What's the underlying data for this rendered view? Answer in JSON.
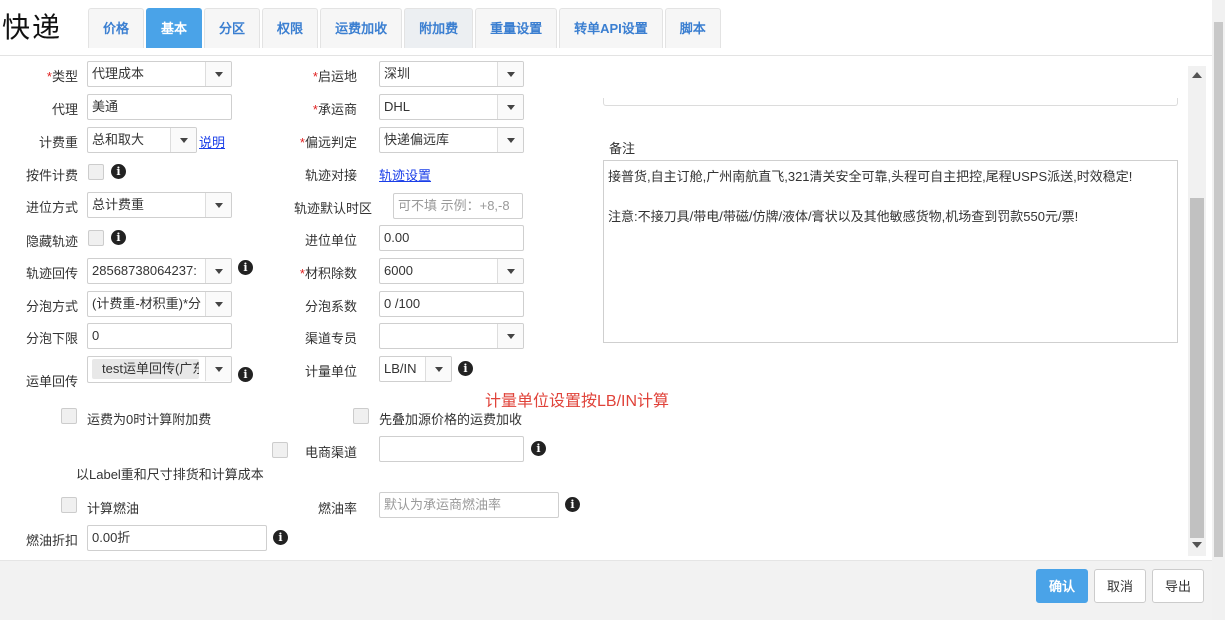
{
  "app_title": "快递",
  "tabs": [
    "价格",
    "基本",
    "分区",
    "权限",
    "运费加收",
    "附加费",
    "重量设置",
    "转单API设置",
    "脚本"
  ],
  "form": {
    "type_label": "类型",
    "type_value": "代理成本",
    "origin_label": "启运地",
    "origin_value": "深圳",
    "agent_label": "代理",
    "agent_value": "美通",
    "carrier_label": "承运商",
    "carrier_value": "DHL",
    "billing_weight_label": "计费重",
    "billing_weight_value": "总和取大",
    "explain_link": "说明",
    "remote_label": "偏远判定",
    "remote_value": "快递偏远库",
    "per_piece_label": "按件计费",
    "tracking_dock_label": "轨迹对接",
    "tracking_setup_link": "轨迹设置",
    "rounding_label": "进位方式",
    "rounding_value": "总计费重",
    "tracking_default_label": "轨迹默认时区",
    "tracking_default_placeholder": "可不填 示例：+8,-8",
    "hide_tracking_label": "隐藏轨迹",
    "rounding_unit_label": "进位单位",
    "rounding_unit_value": "0.00",
    "tracking_callback_label": "轨迹回传",
    "tracking_callback_value": "28568738064237:",
    "volumetric_label": "材积除数",
    "volumetric_value": "6000",
    "bubble_method_label": "分泡方式",
    "bubble_method_value": "(计费重-材积重)*分",
    "bubble_coef_label": "分泡系数",
    "bubble_coef_value": "0 /100",
    "bubble_floor_label": "分泡下限",
    "bubble_floor_value": "0",
    "channel_owner_label": "渠道专员",
    "channel_owner_value": "",
    "waybill_callback_label": "运单回传",
    "waybill_callback_value": "test运单回传(广东",
    "measure_unit_label": "计量单位",
    "measure_unit_value": "LB/IN",
    "measure_note": "计量单位设置按LB/IN计算",
    "zero_freight_label": "运费为0时计算附加费",
    "stack_source_label": "先叠加源价格的运费加收",
    "ecommerce_label": "电商渠道",
    "ecommerce_value": "",
    "label_weight_label": "以Label重和尺寸排货和计算成本",
    "fuel_calc_label": "计算燃油",
    "fuel_rate_label": "燃油率",
    "fuel_rate_placeholder": "默认为承运商燃油率",
    "fuel_discount_label": "燃油折扣",
    "fuel_discount_value": "0.00折"
  },
  "remarks": {
    "label": "备注",
    "line1": "接普货,自主订舱,广州南航直飞,321清关安全可靠,头程可自主把控,尾程USPS派送,时效稳定!",
    "line2": "注意:不接刀具/带电/带磁/仿牌/液体/膏状以及其他敏感货物,机场查到罚款550元/票!"
  },
  "footer": {
    "confirm": "确认",
    "cancel": "取消",
    "export": "导出"
  },
  "colors": {
    "accent": "#4aa3e8",
    "required": "#e02020",
    "note": "#e0433a",
    "link": "#1a3ee8"
  }
}
